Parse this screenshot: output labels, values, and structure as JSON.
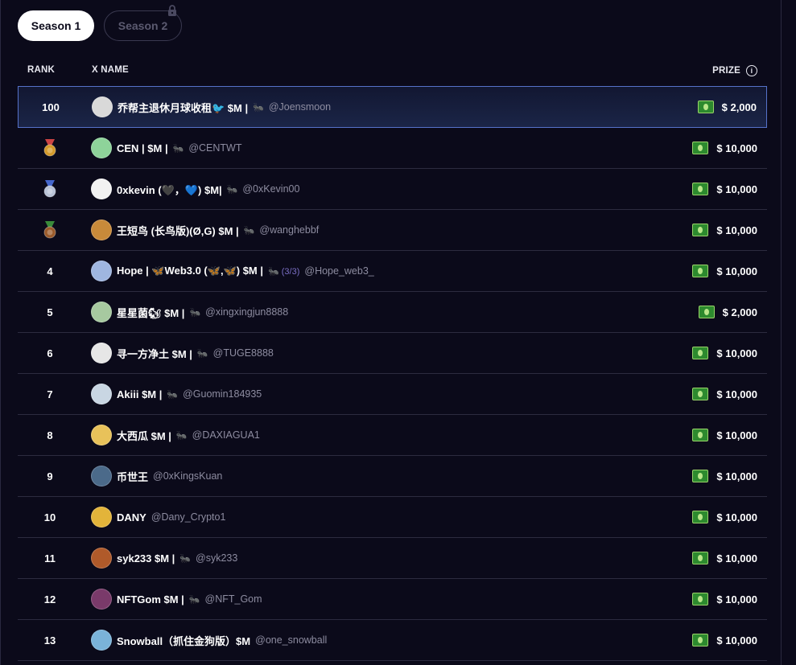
{
  "tabs": [
    {
      "label": "Season 1",
      "active": true
    },
    {
      "label": "Season 2",
      "locked": true
    }
  ],
  "table": {
    "headers": {
      "rank": "RANK",
      "name": "X NAME",
      "prize": "PRIZE"
    },
    "rows": [
      {
        "rank": "100",
        "medal": null,
        "name": "乔帮主退休月球收租🐦 $M |",
        "emoji": "🐜",
        "handle": "@Joensmoon",
        "prize": "$ 2,000",
        "avatar_color": "#d9d9d9",
        "highlight": true
      },
      {
        "rank": "",
        "medal": "gold",
        "name": "CEN | $M |",
        "emoji": "🐜",
        "handle": "@CENTWT",
        "prize": "$ 10,000",
        "avatar_color": "#8ed39a"
      },
      {
        "rank": "",
        "medal": "silver",
        "name": "0xkevin (🖤，💙) $M|",
        "emoji": "🐜",
        "handle": "@0xKevin00",
        "prize": "$ 10,000",
        "avatar_color": "#f2f2f2"
      },
      {
        "rank": "",
        "medal": "bronze",
        "name": "王短鸟 (长鸟版)(Ø,G) $M |",
        "emoji": "🐜",
        "handle": "@wanghebbf",
        "prize": "$ 10,000",
        "avatar_color": "#c88a3a"
      },
      {
        "rank": "4",
        "medal": null,
        "name": "Hope | 🦋Web3.0 (🦋,🦋) $M |",
        "emoji": "🐜 (3/3)",
        "handle": "@Hope_web3_",
        "prize": "$ 10,000",
        "avatar_color": "#9fb6e0"
      },
      {
        "rank": "5",
        "medal": null,
        "name": "星星菌🐿 $M |",
        "emoji": "🐜",
        "handle": "@xingxingjun8888",
        "prize": "$ 2,000",
        "avatar_color": "#a7c9a0"
      },
      {
        "rank": "6",
        "medal": null,
        "name": "寻一方净土 $M |",
        "emoji": "🐜",
        "handle": "@TUGE8888",
        "prize": "$ 10,000",
        "avatar_color": "#e6e6e6"
      },
      {
        "rank": "7",
        "medal": null,
        "name": "Akiii $M |",
        "emoji": "🐜",
        "handle": "@Guomin184935",
        "prize": "$ 10,000",
        "avatar_color": "#c9d6e3"
      },
      {
        "rank": "8",
        "medal": null,
        "name": "大西瓜 $M |",
        "emoji": "🐜",
        "handle": "@DAXIAGUA1",
        "prize": "$ 10,000",
        "avatar_color": "#e8c25a"
      },
      {
        "rank": "9",
        "medal": null,
        "name": "币世王",
        "emoji": "",
        "handle": "@0xKingsKuan",
        "prize": "$ 10,000",
        "avatar_color": "#4b6a8a"
      },
      {
        "rank": "10",
        "medal": null,
        "name": "DANY",
        "emoji": "",
        "handle": "@Dany_Crypto1",
        "prize": "$ 10,000",
        "avatar_color": "#e3b43a"
      },
      {
        "rank": "11",
        "medal": null,
        "name": "syk233 $M |",
        "emoji": "🐜",
        "handle": "@syk233",
        "prize": "$ 10,000",
        "avatar_color": "#b05a2a"
      },
      {
        "rank": "12",
        "medal": null,
        "name": "NFTGom $M |",
        "emoji": "🐜",
        "handle": "@NFT_Gom",
        "prize": "$ 10,000",
        "avatar_color": "#7a3a6a"
      },
      {
        "rank": "13",
        "medal": null,
        "name": "Snowball（抓住金狗版）$M",
        "emoji": "",
        "handle": "@one_snowball",
        "prize": "$ 10,000",
        "avatar_color": "#7ab3d9"
      }
    ]
  },
  "colors": {
    "gold": "#d49a2a",
    "silver": "#b8c2d6",
    "bronze": "#9a5a2a"
  }
}
